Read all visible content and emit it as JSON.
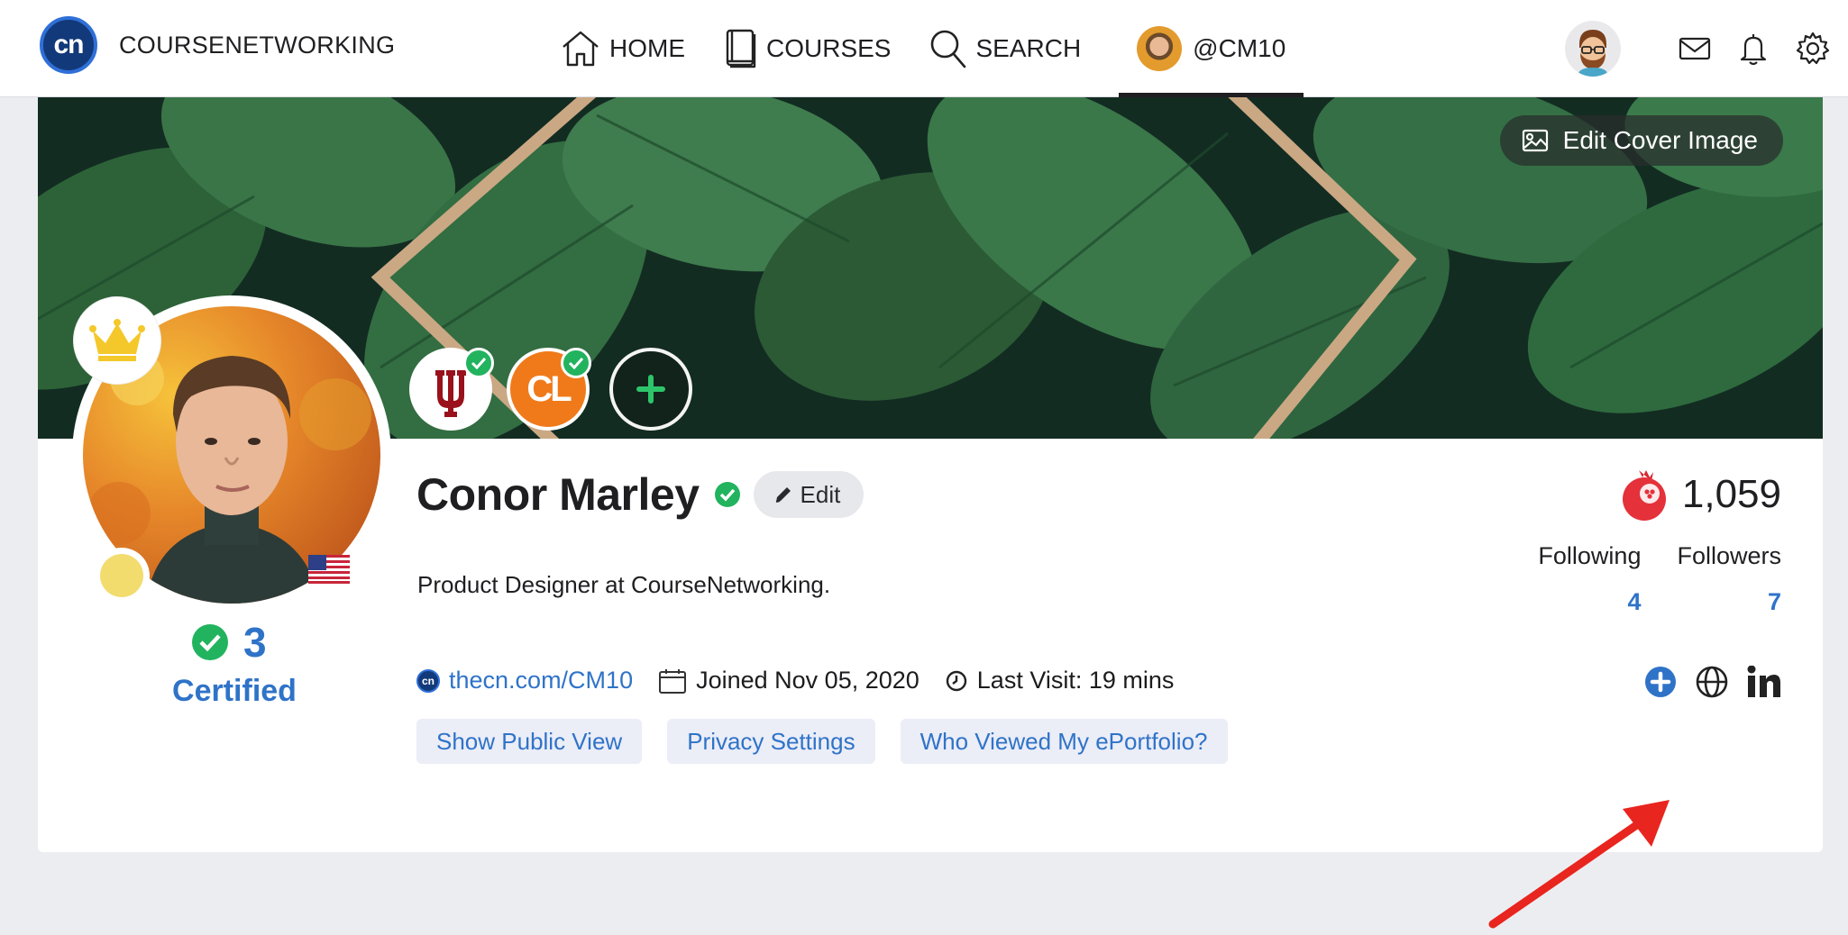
{
  "nav": {
    "logo_text": "cn",
    "brand": "COURSENETWORKING",
    "home": "HOME",
    "courses": "COURSES",
    "search": "SEARCH",
    "profile": "@CM10"
  },
  "cover": {
    "edit_label": "Edit Cover Image"
  },
  "badges": {
    "iu_letter": "Ψ",
    "cl_letter": "CL"
  },
  "profile": {
    "name": "Conor Marley",
    "edit_label": "Edit",
    "bio": "Product Designer at CourseNetworking.",
    "cert_count": "3",
    "cert_label": "Certified",
    "url": "thecn.com/CM10",
    "url_logo": "cn",
    "joined": "Joined Nov 05, 2020",
    "last_visit": "Last Visit: 19 mins"
  },
  "actions": {
    "public_view": "Show Public View",
    "privacy": "Privacy Settings",
    "viewed": "Who Viewed My ePortfolio?"
  },
  "stats": {
    "points": "1,059",
    "following_label": "Following",
    "followers_label": "Followers",
    "following": "4",
    "followers": "7"
  },
  "colors": {
    "accent": "#2f73c8",
    "verified": "#22b35e",
    "annotation_arrow": "#e8251e"
  }
}
